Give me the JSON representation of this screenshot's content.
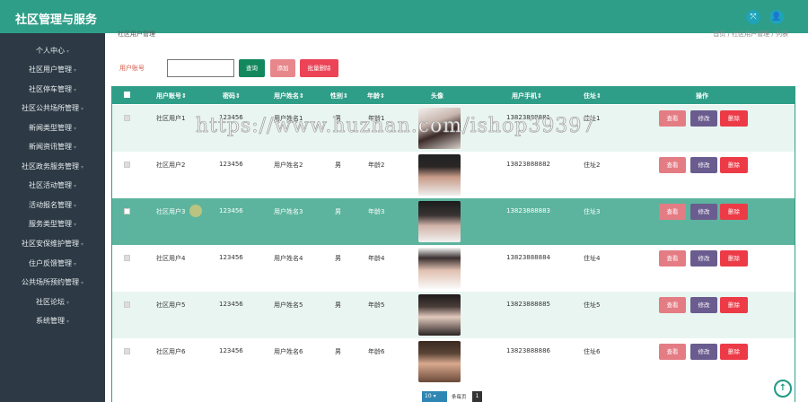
{
  "app": {
    "title": "社区管理与服务"
  },
  "header": {
    "fullscreen_icon": "fullscreen-icon",
    "user_icon": "user-icon"
  },
  "sidebar": {
    "items": [
      {
        "label": "个人中心"
      },
      {
        "label": "社区用户管理"
      },
      {
        "label": "社区停车管理"
      },
      {
        "label": "社区公共场所管理"
      },
      {
        "label": "新闻类型管理"
      },
      {
        "label": "新闻资讯管理"
      },
      {
        "label": "社区政务服务管理"
      },
      {
        "label": "社区活动管理"
      },
      {
        "label": "活动报名管理"
      },
      {
        "label": "服务类型管理"
      },
      {
        "label": "社区安保维护管理"
      },
      {
        "label": "住户反馈管理"
      },
      {
        "label": "公共场所预约管理"
      },
      {
        "label": "社区论坛"
      },
      {
        "label": "系统管理"
      }
    ]
  },
  "breadcrumb": {
    "left": "社区用户管理",
    "right": "首页 / 社区用户管理 / 列表"
  },
  "search": {
    "label": "用户账号",
    "placeholder": "",
    "query": "查询",
    "add": "添加",
    "batch_delete": "批量删除"
  },
  "table": {
    "headers": [
      "用户账号⇕",
      "密码⇕",
      "用户姓名⇕",
      "性别⇕",
      "年龄⇕",
      "头像",
      "用户手机⇕",
      "住址⇕",
      "操作"
    ],
    "rows": [
      {
        "account": "社区用户1",
        "password": "123456",
        "name": "用户姓名1",
        "gender": "男",
        "age": "年龄1",
        "phone": "13823888881",
        "address": "住址1"
      },
      {
        "account": "社区用户2",
        "password": "123456",
        "name": "用户姓名2",
        "gender": "男",
        "age": "年龄2",
        "phone": "13823888882",
        "address": "住址2"
      },
      {
        "account": "社区用户3",
        "password": "123456",
        "name": "用户姓名3",
        "gender": "男",
        "age": "年龄3",
        "phone": "13823888883",
        "address": "住址3"
      },
      {
        "account": "社区用户4",
        "password": "123456",
        "name": "用户姓名4",
        "gender": "男",
        "age": "年龄4",
        "phone": "13823888884",
        "address": "住址4"
      },
      {
        "account": "社区用户5",
        "password": "123456",
        "name": "用户姓名5",
        "gender": "男",
        "age": "年龄5",
        "phone": "13823888885",
        "address": "住址5"
      },
      {
        "account": "社区用户6",
        "password": "123456",
        "name": "用户姓名6",
        "gender": "男",
        "age": "年龄6",
        "phone": "13823888886",
        "address": "住址6"
      }
    ],
    "actions": {
      "view": "查看",
      "edit": "修改",
      "delete": "删除"
    }
  },
  "pager": {
    "page_size": "10",
    "total_label": "条每页",
    "current_page": "1"
  },
  "watermark": "https://www.huzhan.com/ishop39397",
  "colors": {
    "primary": "#2f9e88",
    "sidebar": "#2d3a45",
    "danger": "#ec3b47",
    "edit": "#6a5c8f"
  }
}
